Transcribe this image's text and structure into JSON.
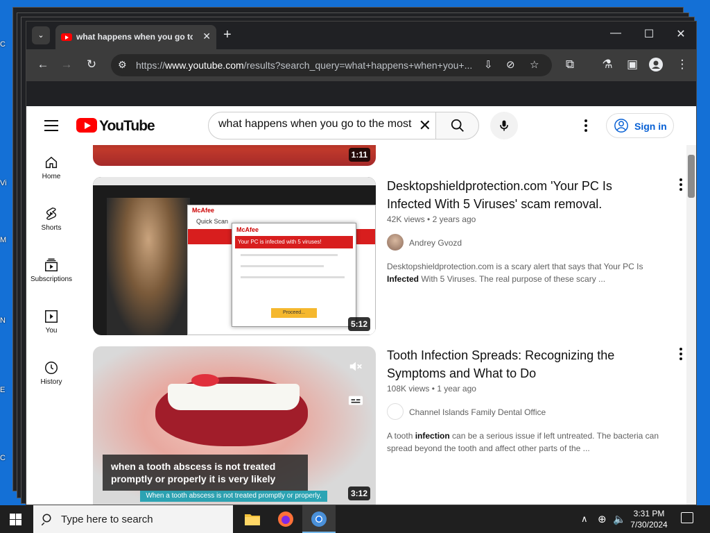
{
  "desktop": {
    "icon_letters": [
      "C",
      "Vi",
      "M",
      "N",
      "E",
      "C"
    ]
  },
  "browser": {
    "tab": {
      "title": "what happens when you go to"
    },
    "window_controls": {
      "minimize": "—",
      "maximize": "☐",
      "close": "✕"
    },
    "address": {
      "scheme": "https://",
      "host": "www.youtube.com",
      "path": "/results?search_query=what+happens+when+you+..."
    }
  },
  "youtube": {
    "logo_text": "YouTube",
    "search": {
      "value": "what happens when you go to the most"
    },
    "signin_label": "Sign in",
    "guide": [
      {
        "label": "Home",
        "icon": "home-icon"
      },
      {
        "label": "Shorts",
        "icon": "shorts-icon"
      },
      {
        "label": "Subscriptions",
        "icon": "subscriptions-icon"
      },
      {
        "label": "You",
        "icon": "you-icon"
      },
      {
        "label": "History",
        "icon": "history-icon"
      }
    ],
    "videos": [
      {
        "duration": "1:11"
      },
      {
        "duration": "5:12",
        "title": "Desktopshieldprotection.com 'Your PC Is Infected With 5 Viruses' scam removal.",
        "views": "42K views",
        "age": "2 years ago",
        "channel": "Andrey Gvozd",
        "desc_a": "Desktopshieldprotection.com is a scary alert that says that Your PC Is ",
        "desc_b": "Infected",
        "desc_c": " With 5 Viruses. The real purpose of these scary ...",
        "thumb": {
          "brand": "McAfee",
          "scan_label": "Quick Scan",
          "alert": "Your PC is infected with 5 viruses!",
          "button": "Proceed..."
        }
      },
      {
        "duration": "3:12",
        "title": "Tooth Infection Spreads: Recognizing the Symptoms and What to Do",
        "views": "108K views",
        "age": "1 year ago",
        "channel": "Channel Islands Family Dental Office",
        "desc_a": "A tooth ",
        "desc_b": "infection",
        "desc_c": " can be a serious issue if left untreated. The bacteria can spread beyond the tooth and affect other parts of the ...",
        "caption_1": "when a tooth abscess is not treated",
        "caption_2": "promptly or properly it is very likely",
        "subtitle": "When a tooth abscess is not treated promptly or properly,"
      }
    ]
  },
  "taskbar": {
    "search_placeholder": "Type here to search",
    "time": "3:31 PM",
    "date": "7/30/2024"
  }
}
